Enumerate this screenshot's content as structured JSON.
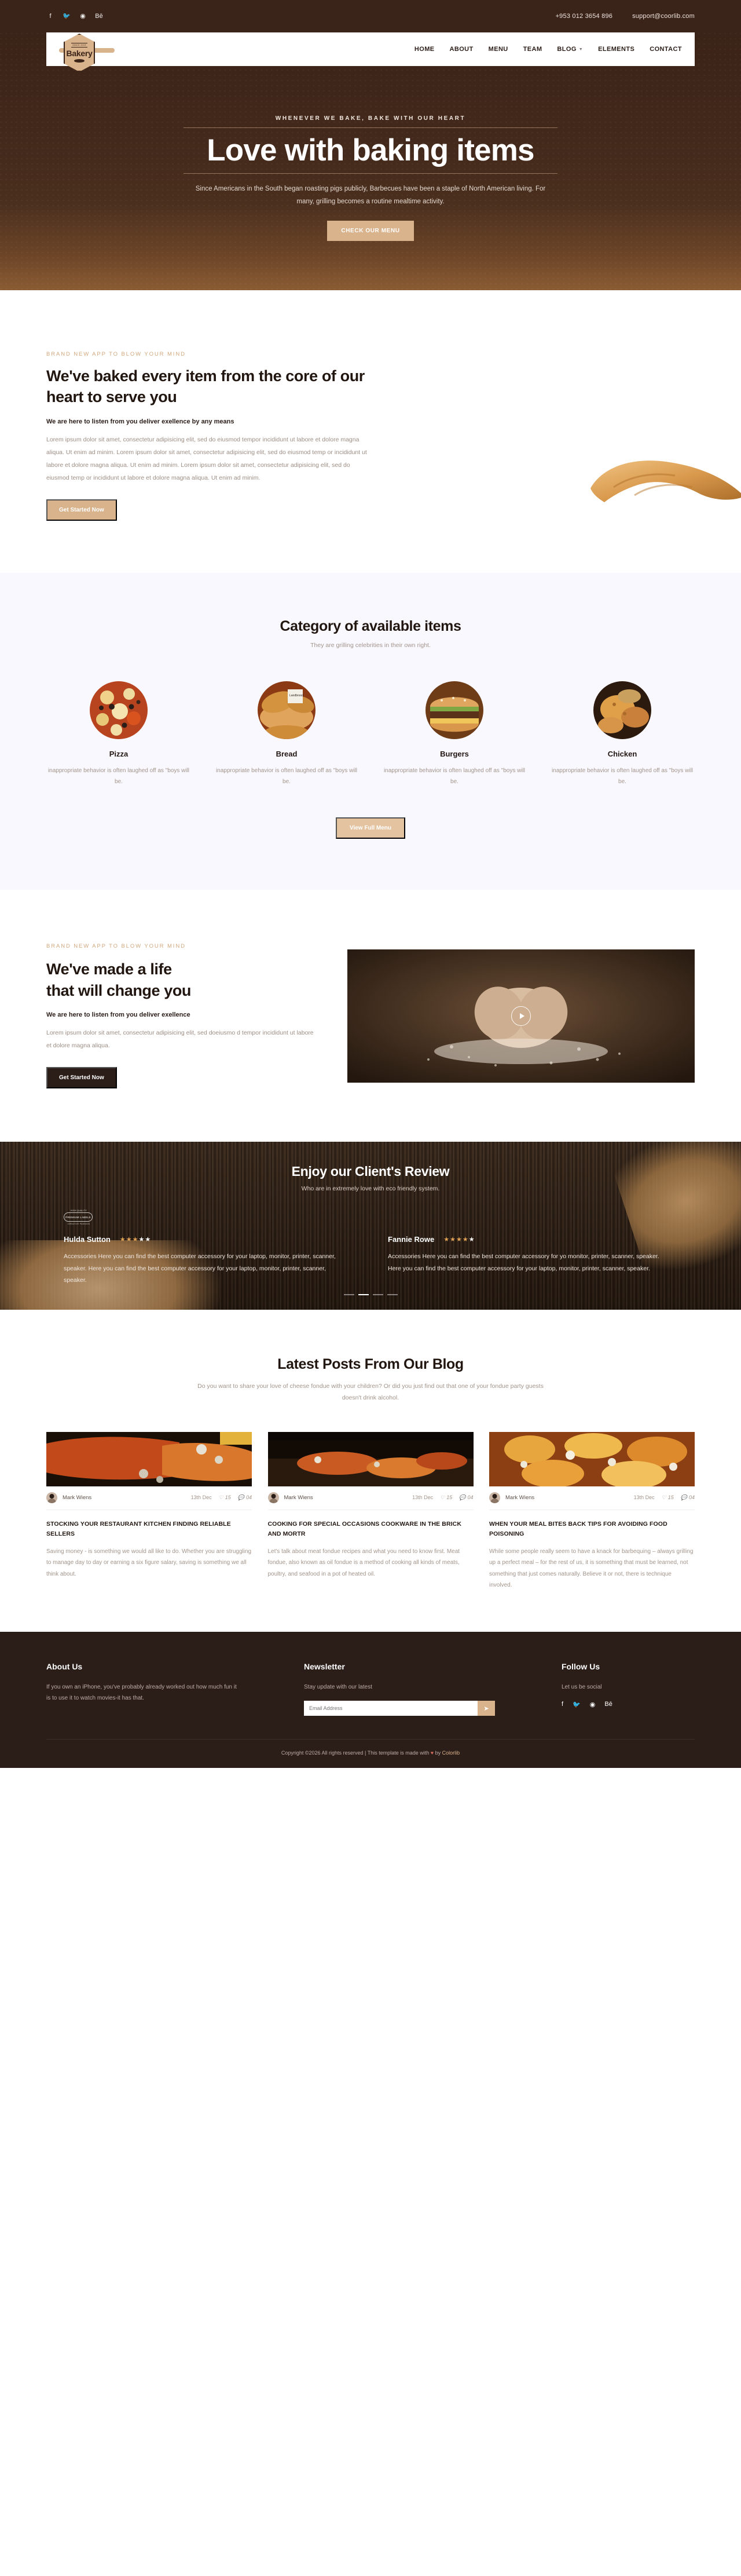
{
  "topbar": {
    "social": [
      {
        "name": "facebook-icon",
        "glyph": "f"
      },
      {
        "name": "twitter-icon",
        "glyph": "🐦"
      },
      {
        "name": "dribbble-icon",
        "glyph": "◉"
      },
      {
        "name": "behance-icon",
        "glyph": "Bē"
      }
    ],
    "phone": "+953 012 3654 896",
    "email": "support@coorlib.com"
  },
  "nav": {
    "logo_since": "SINCE 2019",
    "logo_text": "Bakery",
    "items": [
      {
        "label": "HOME",
        "dropdown": false
      },
      {
        "label": "ABOUT",
        "dropdown": false
      },
      {
        "label": "MENU",
        "dropdown": false
      },
      {
        "label": "TEAM",
        "dropdown": false
      },
      {
        "label": "BLOG",
        "dropdown": true
      },
      {
        "label": "ELEMENTS",
        "dropdown": false
      },
      {
        "label": "CONTACT",
        "dropdown": false
      }
    ]
  },
  "hero": {
    "eyebrow": "WHENEVER WE BAKE, BAKE WITH OUR HEART",
    "title": "Love with baking items",
    "desc": "Since Americans in the South began roasting pigs publicly, Barbecues have been a staple of North American living. For many, grilling becomes a routine mealtime activity.",
    "cta": "CHECK OUR MENU"
  },
  "about": {
    "eyebrow": "BRAND NEW APP TO BLOW YOUR MIND",
    "title": "We've baked every item from the core of our heart to serve you",
    "lead": "We are here to listen from you deliver exellence by any means",
    "para": "Lorem ipsum dolor sit amet, consectetur adipisicing elit, sed do eiusmod tempor incididunt ut labore et dolore magna aliqua. Ut enim ad minim. Lorem ipsum dolor sit amet, consectetur adipisicing elit, sed do eiusmod temp or incididunt ut labore et dolore magna aliqua. Ut enim ad minim. Lorem ipsum dolor sit amet, consectetur adipisicing elit, sed do eiusmod temp or incididunt ut labore et dolore magna aliqua. Ut enim ad minim.",
    "cta": "Get Started Now"
  },
  "categories": {
    "title": "Category of available items",
    "subtitle": "They are grilling celebrities in their own right.",
    "cta": "View Full Menu",
    "items": [
      {
        "name": "Pizza",
        "desc": "inappropriate behavior is often laughed off as \"boys will be."
      },
      {
        "name": "Bread",
        "desc": "inappropriate behavior is often laughed off as \"boys will be."
      },
      {
        "name": "Burgers",
        "desc": "inappropriate behavior is often laughed off as \"boys will be."
      },
      {
        "name": "Chicken",
        "desc": "inappropriate behavior is often laughed off as \"boys will be."
      }
    ]
  },
  "life": {
    "eyebrow": "BRAND NEW APP TO BLOW YOUR MIND",
    "title_line1": "We've made a life",
    "title_line2": "that will change you",
    "lead": "We are here to listen from you deliver exellence",
    "para": "Lorem ipsum dolor sit amet, consectetur adipisicing elit, sed doeiusmo d tempor incididunt ut labore et dolore magna aliqua.",
    "cta": "Get Started Now",
    "play_label": "play-video"
  },
  "reviews": {
    "title": "Enjoy our Client's Review",
    "subtitle": "Who are in extremely love with eco friendly system.",
    "badge_top": "HIGH QUALITY",
    "badge_mid": "PREMIUM LABELS",
    "badge_bot": "CREATIVE PASSION",
    "items": [
      {
        "name": "Hulda Sutton",
        "rating": 3,
        "text": "Accessories Here you can find the best computer accessory for your laptop, monitor, printer, scanner, speaker. Here you can find the best computer accessory for your laptop, monitor, printer, scanner, speaker."
      },
      {
        "name": "Fannie Rowe",
        "rating": 4,
        "text": "Accessories Here you can find the best computer accessory for yo monitor, printer, scanner, speaker. Here you can find the best computer accessory for your laptop, monitor, printer, scanner, speaker."
      }
    ],
    "dots": 4,
    "active_dot": 1
  },
  "blog": {
    "title": "Latest Posts From Our Blog",
    "subtitle": "Do you want to share your love of cheese fondue with your children? Or did you just find out that one of your fondue party guests doesn't drink alcohol.",
    "posts": [
      {
        "author": "Mark Wiens",
        "date": "13th Dec",
        "likes": "15",
        "comments": "04",
        "title": "STOCKING YOUR RESTAURANT KITCHEN FINDING RELIABLE SELLERS",
        "excerpt": "Saving money - is something we would all like to do. Whether you are struggling to manage day to day or earning a six figure salary, saving is something we all think about."
      },
      {
        "author": "Mark Wiens",
        "date": "13th Dec",
        "likes": "15",
        "comments": "04",
        "title": "COOKING FOR SPECIAL OCCASIONS COOKWARE IN THE BRICK AND MORTR",
        "excerpt": "Let's talk about meat fondue recipes and what you need to know first. Meat fondue, also known as oil fondue is a method of cooking all kinds of meats, poultry, and seafood in a pot of heated oil."
      },
      {
        "author": "Mark Wiens",
        "date": "13th Dec",
        "likes": "15",
        "comments": "04",
        "title": "WHEN YOUR MEAL BITES BACK TIPS FOR AVOIDING FOOD POISONING",
        "excerpt": "While some people really seem to have a knack for barbequing – always grilling up a perfect meal – for the rest of us, it is something that must be learned, not something that just comes naturally. Believe it or not, there is technique involved."
      }
    ]
  },
  "footer": {
    "about_title": "About Us",
    "about_text": "If you own an iPhone, you've probably already worked out how much fun it is to use it to watch movies-it has that.",
    "news_title": "Newsletter",
    "news_text": "Stay update with our latest",
    "news_placeholder": "Email Address",
    "news_button": "➤",
    "follow_title": "Follow Us",
    "follow_text": "Let us be social",
    "follow_icons": [
      {
        "name": "facebook-icon",
        "glyph": "f"
      },
      {
        "name": "twitter-icon",
        "glyph": "🐦"
      },
      {
        "name": "dribbble-icon",
        "glyph": "◉"
      },
      {
        "name": "behance-icon",
        "glyph": "Bē"
      }
    ],
    "copyright_prefix": "Copyright ©2026 All rights reserved | This template is made with ",
    "copyright_heart": "♥",
    "copyright_suffix": " by ",
    "copyright_link": "Colorlib"
  },
  "colors": {
    "brand_dark": "#2b1d18",
    "brand_tan": "#d9b38c",
    "hero_bg": "#3a2318",
    "muted": "#a2948a",
    "star": "#e0a355"
  }
}
